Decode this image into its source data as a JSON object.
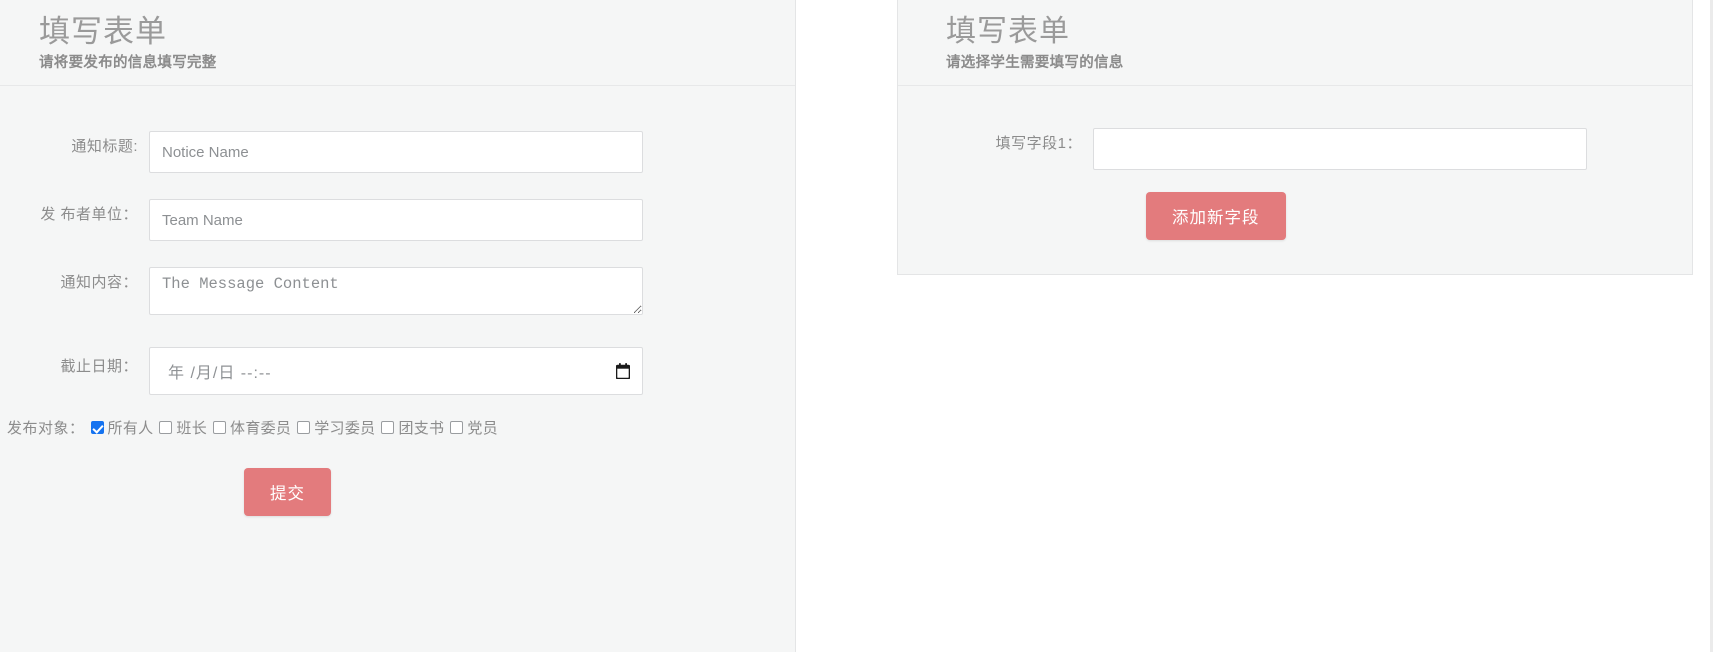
{
  "left_panel": {
    "title": "填写表单",
    "subtitle": "请将要发布的信息填写完整",
    "fields": [
      {
        "label": "通知标题:",
        "placeholder": "Notice Name",
        "value": "",
        "type": "text"
      },
      {
        "label": "发 布者单位：",
        "placeholder": "Team Name",
        "value": "",
        "type": "text"
      },
      {
        "label": "通知内容：",
        "placeholder": "The Message Content",
        "value": "",
        "type": "textarea"
      },
      {
        "label": "截止日期：",
        "placeholder": "年 /月/日 --:--",
        "value": "",
        "type": "datetime-local"
      }
    ],
    "datetime_display": {
      "year": "年",
      "sep1": "/",
      "month": "月",
      "sep2": "/",
      "day": "日",
      "time": "--:--",
      "full": "年 /月/日  --:--"
    },
    "audience": {
      "label": "发布对象：",
      "options": [
        {
          "label": "所有人",
          "checked": true
        },
        {
          "label": "班长",
          "checked": false
        },
        {
          "label": "体育委员",
          "checked": false
        },
        {
          "label": "学习委员",
          "checked": false
        },
        {
          "label": "团支书",
          "checked": false
        },
        {
          "label": "党员",
          "checked": false
        }
      ]
    },
    "submit_label": "提交"
  },
  "right_panel": {
    "title": "填写表单",
    "subtitle": "请选择学生需要填写的信息",
    "fields": [
      {
        "label": "填写字段1：",
        "placeholder": "",
        "value": "",
        "type": "text"
      }
    ],
    "add_field_label": "添加新字段"
  },
  "icons": {
    "calendar": "calendar-icon"
  },
  "colors": {
    "accent_button": "#e37b7d",
    "checkbox_checked": "#1573f0",
    "panel_bg": "#f5f6f6",
    "panel_border": "#e4e5e6",
    "title_text": "#9a9a9a",
    "label_text": "#8c8c8c",
    "placeholder_text": "#8d9093"
  }
}
